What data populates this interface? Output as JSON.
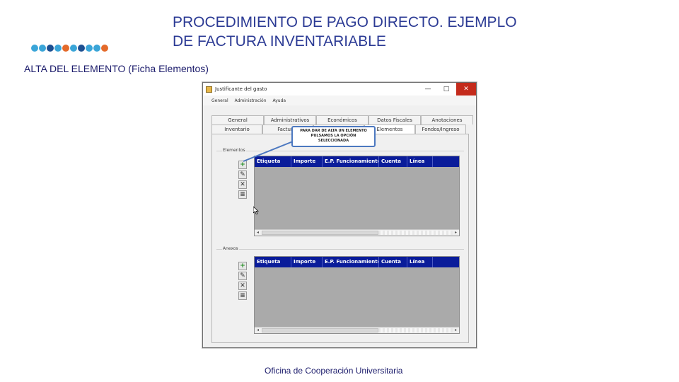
{
  "slide": {
    "title_line1": "PROCEDIMIENTO DE PAGO DIRECTO. EJEMPLO",
    "title_line2": "DE FACTURA INVENTARIABLE",
    "subtitle": "ALTA DEL ELEMENTO (Ficha Elementos)",
    "footer": "Oficina de Cooperación Universitaria",
    "dot_colors": [
      "#3aa5d8",
      "#3aa5d8",
      "#1d4f91",
      "#3aa5d8",
      "#e46a2a",
      "#3aa5d8",
      "#1d4f91",
      "#3aa5d8",
      "#3aa5d8",
      "#e46a2a"
    ]
  },
  "window": {
    "title": "Justificante del gasto",
    "minimize": "—",
    "maximize": "□",
    "close": "✕",
    "menu": [
      "General",
      "Administración",
      "Ayuda"
    ]
  },
  "tabs_row1": [
    "General",
    "Administrativos",
    "Económicos",
    "Datos Fiscales",
    "Anotaciones"
  ],
  "tabs_row2": [
    "Inventario",
    "Facturas",
    "",
    "Elementos",
    "Fondos/Ingreso"
  ],
  "callout": {
    "line1": "PARA DAR DE ALTA UN ELEMENTO",
    "line2": "PULSAMOS LA OPCIÓN",
    "line3": "SELECCIONADA"
  },
  "group1": {
    "label": "Elementos",
    "columns": [
      "Etiqueta",
      "Importe",
      "E.P. Funcionamiento",
      "Cuenta",
      "Línea"
    ]
  },
  "group2": {
    "label": "Anexos",
    "columns": [
      "Etiqueta",
      "Importe",
      "E.P. Funcionamiento",
      "Cuenta",
      "Línea"
    ]
  },
  "toolbar_icons": [
    "add-icon",
    "edit-icon",
    "delete-icon",
    "detail-icon"
  ],
  "scroll": {
    "left_arrow": "◂",
    "right_arrow": "▸"
  }
}
